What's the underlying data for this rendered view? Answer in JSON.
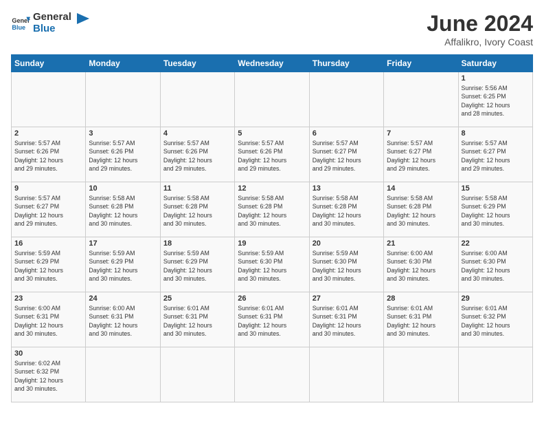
{
  "header": {
    "logo_general": "General",
    "logo_blue": "Blue",
    "title": "June 2024",
    "subtitle": "Affalikro, Ivory Coast"
  },
  "days_of_week": [
    "Sunday",
    "Monday",
    "Tuesday",
    "Wednesday",
    "Thursday",
    "Friday",
    "Saturday"
  ],
  "weeks": [
    [
      {
        "day": "",
        "info": ""
      },
      {
        "day": "",
        "info": ""
      },
      {
        "day": "",
        "info": ""
      },
      {
        "day": "",
        "info": ""
      },
      {
        "day": "",
        "info": ""
      },
      {
        "day": "",
        "info": ""
      },
      {
        "day": "1",
        "info": "Sunrise: 5:56 AM\nSunset: 6:25 PM\nDaylight: 12 hours\nand 28 minutes."
      }
    ],
    [
      {
        "day": "2",
        "info": "Sunrise: 5:57 AM\nSunset: 6:26 PM\nDaylight: 12 hours\nand 29 minutes."
      },
      {
        "day": "3",
        "info": "Sunrise: 5:57 AM\nSunset: 6:26 PM\nDaylight: 12 hours\nand 29 minutes."
      },
      {
        "day": "4",
        "info": "Sunrise: 5:57 AM\nSunset: 6:26 PM\nDaylight: 12 hours\nand 29 minutes."
      },
      {
        "day": "5",
        "info": "Sunrise: 5:57 AM\nSunset: 6:26 PM\nDaylight: 12 hours\nand 29 minutes."
      },
      {
        "day": "6",
        "info": "Sunrise: 5:57 AM\nSunset: 6:27 PM\nDaylight: 12 hours\nand 29 minutes."
      },
      {
        "day": "7",
        "info": "Sunrise: 5:57 AM\nSunset: 6:27 PM\nDaylight: 12 hours\nand 29 minutes."
      },
      {
        "day": "8",
        "info": "Sunrise: 5:57 AM\nSunset: 6:27 PM\nDaylight: 12 hours\nand 29 minutes."
      }
    ],
    [
      {
        "day": "9",
        "info": "Sunrise: 5:57 AM\nSunset: 6:27 PM\nDaylight: 12 hours\nand 29 minutes."
      },
      {
        "day": "10",
        "info": "Sunrise: 5:58 AM\nSunset: 6:28 PM\nDaylight: 12 hours\nand 30 minutes."
      },
      {
        "day": "11",
        "info": "Sunrise: 5:58 AM\nSunset: 6:28 PM\nDaylight: 12 hours\nand 30 minutes."
      },
      {
        "day": "12",
        "info": "Sunrise: 5:58 AM\nSunset: 6:28 PM\nDaylight: 12 hours\nand 30 minutes."
      },
      {
        "day": "13",
        "info": "Sunrise: 5:58 AM\nSunset: 6:28 PM\nDaylight: 12 hours\nand 30 minutes."
      },
      {
        "day": "14",
        "info": "Sunrise: 5:58 AM\nSunset: 6:28 PM\nDaylight: 12 hours\nand 30 minutes."
      },
      {
        "day": "15",
        "info": "Sunrise: 5:58 AM\nSunset: 6:29 PM\nDaylight: 12 hours\nand 30 minutes."
      }
    ],
    [
      {
        "day": "16",
        "info": "Sunrise: 5:59 AM\nSunset: 6:29 PM\nDaylight: 12 hours\nand 30 minutes."
      },
      {
        "day": "17",
        "info": "Sunrise: 5:59 AM\nSunset: 6:29 PM\nDaylight: 12 hours\nand 30 minutes."
      },
      {
        "day": "18",
        "info": "Sunrise: 5:59 AM\nSunset: 6:29 PM\nDaylight: 12 hours\nand 30 minutes."
      },
      {
        "day": "19",
        "info": "Sunrise: 5:59 AM\nSunset: 6:30 PM\nDaylight: 12 hours\nand 30 minutes."
      },
      {
        "day": "20",
        "info": "Sunrise: 5:59 AM\nSunset: 6:30 PM\nDaylight: 12 hours\nand 30 minutes."
      },
      {
        "day": "21",
        "info": "Sunrise: 6:00 AM\nSunset: 6:30 PM\nDaylight: 12 hours\nand 30 minutes."
      },
      {
        "day": "22",
        "info": "Sunrise: 6:00 AM\nSunset: 6:30 PM\nDaylight: 12 hours\nand 30 minutes."
      }
    ],
    [
      {
        "day": "23",
        "info": "Sunrise: 6:00 AM\nSunset: 6:31 PM\nDaylight: 12 hours\nand 30 minutes."
      },
      {
        "day": "24",
        "info": "Sunrise: 6:00 AM\nSunset: 6:31 PM\nDaylight: 12 hours\nand 30 minutes."
      },
      {
        "day": "25",
        "info": "Sunrise: 6:01 AM\nSunset: 6:31 PM\nDaylight: 12 hours\nand 30 minutes."
      },
      {
        "day": "26",
        "info": "Sunrise: 6:01 AM\nSunset: 6:31 PM\nDaylight: 12 hours\nand 30 minutes."
      },
      {
        "day": "27",
        "info": "Sunrise: 6:01 AM\nSunset: 6:31 PM\nDaylight: 12 hours\nand 30 minutes."
      },
      {
        "day": "28",
        "info": "Sunrise: 6:01 AM\nSunset: 6:31 PM\nDaylight: 12 hours\nand 30 minutes."
      },
      {
        "day": "29",
        "info": "Sunrise: 6:01 AM\nSunset: 6:32 PM\nDaylight: 12 hours\nand 30 minutes."
      }
    ],
    [
      {
        "day": "30",
        "info": "Sunrise: 6:02 AM\nSunset: 6:32 PM\nDaylight: 12 hours\nand 30 minutes."
      },
      {
        "day": "",
        "info": ""
      },
      {
        "day": "",
        "info": ""
      },
      {
        "day": "",
        "info": ""
      },
      {
        "day": "",
        "info": ""
      },
      {
        "day": "",
        "info": ""
      },
      {
        "day": "",
        "info": ""
      }
    ]
  ]
}
